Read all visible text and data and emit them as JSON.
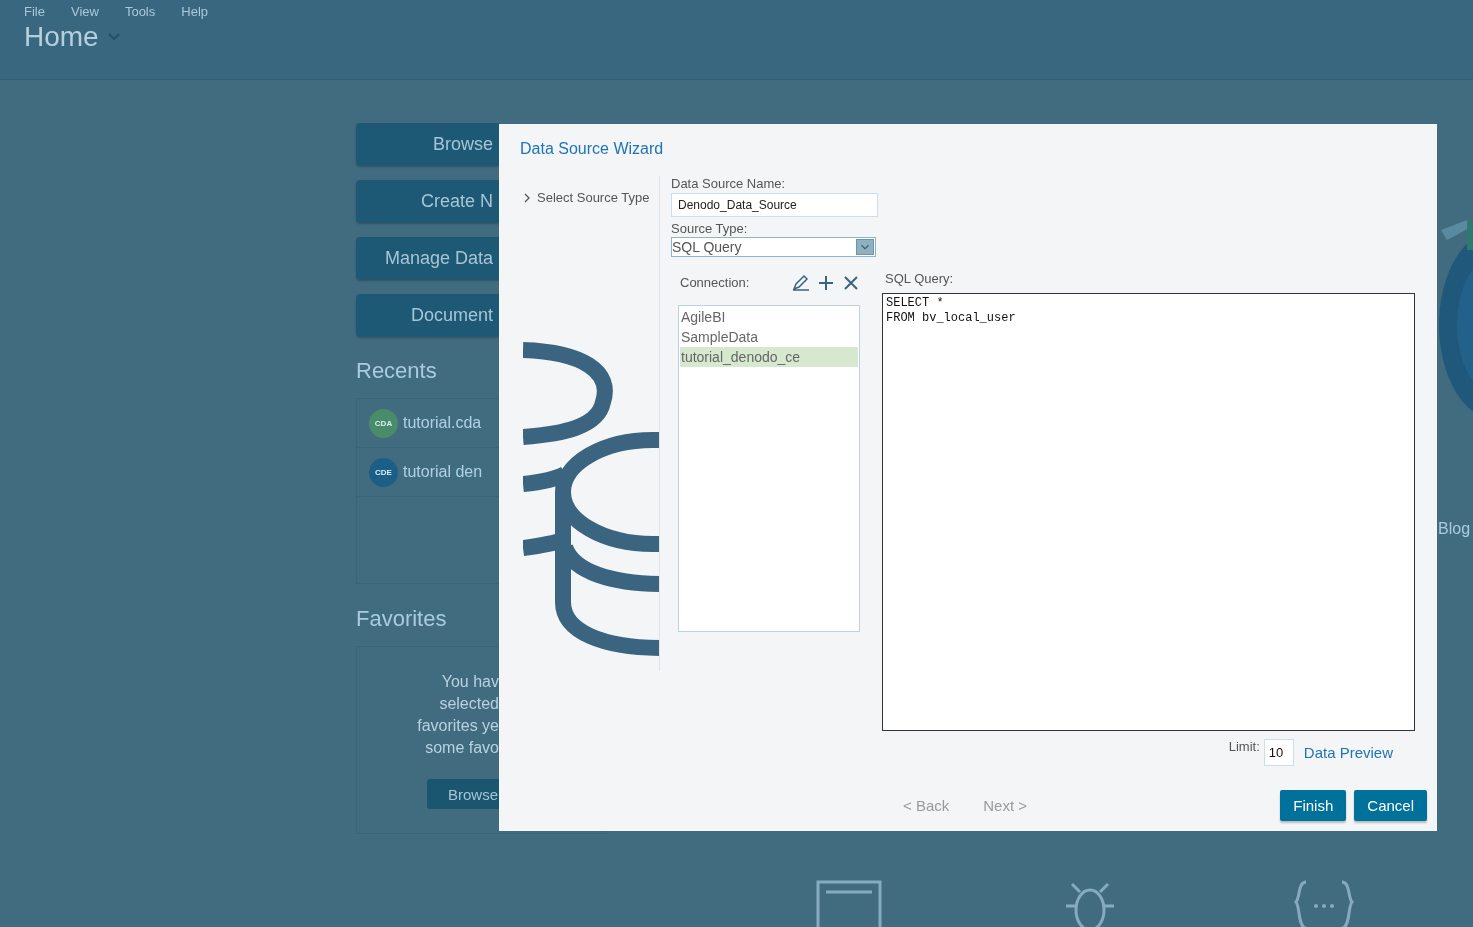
{
  "menu": [
    "File",
    "View",
    "Tools",
    "Help"
  ],
  "page_title": "Home",
  "actions": [
    "Browse",
    "Create N",
    "Manage Data",
    "Document"
  ],
  "recents": {
    "title": "Recents",
    "items": [
      {
        "badge": "CDA",
        "name": "tutorial.cda",
        "color": "#4a8c6a"
      },
      {
        "badge": "CDE",
        "name": "tutorial den",
        "color": "#1c5f86"
      }
    ]
  },
  "favorites": {
    "title": "Favorites",
    "message_lines": [
      "You hav",
      "selected",
      "favorites ye",
      "some favo"
    ],
    "button": "Browse"
  },
  "side_heading": "Blog",
  "dialog": {
    "title": "Data Source Wizard",
    "steps": [
      "Select Source Type"
    ],
    "name_label": "Data Source Name:",
    "name_value": "Denodo_Data_Source",
    "type_label": "Source Type:",
    "type_value": "SQL Query",
    "connection_label": "Connection:",
    "connections": [
      {
        "label": "AgileBI",
        "selected": false
      },
      {
        "label": "SampleData",
        "selected": false
      },
      {
        "label": "tutorial_denodo_ce",
        "selected": true
      }
    ],
    "sql_label": "SQL Query:",
    "sql": "SELECT *\nFROM bv_local_user",
    "limit_label": "Limit:",
    "limit_value": "10",
    "preview_link": "Data Preview",
    "buttons": [
      {
        "label": "< Back",
        "kind": "nav",
        "disabled": true
      },
      {
        "label": "Next >",
        "kind": "nav",
        "disabled": true
      },
      {
        "label": "Finish",
        "kind": "primary",
        "disabled": false
      },
      {
        "label": "Cancel",
        "kind": "primary",
        "disabled": false
      }
    ]
  }
}
